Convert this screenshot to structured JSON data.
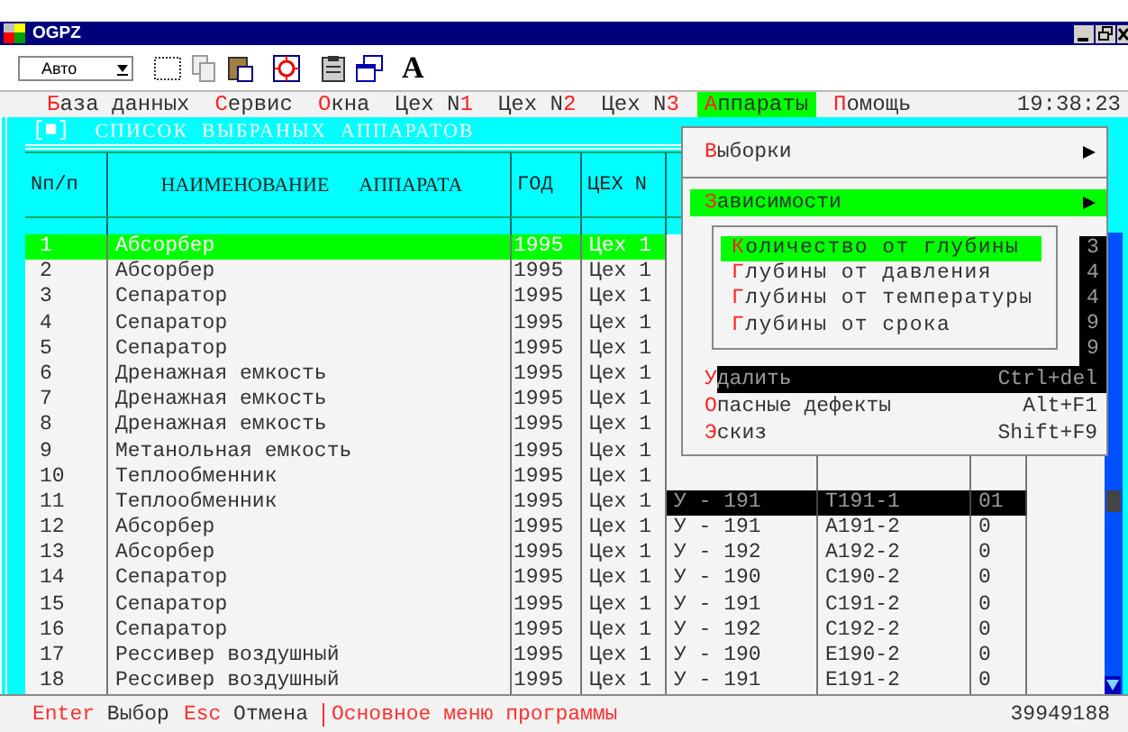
{
  "window": {
    "title": "OGPZ"
  },
  "toolbar": {
    "mode_select": "Авто",
    "font_button": "A"
  },
  "menu_bar": {
    "items": [
      {
        "key": "Б",
        "after": "аза данных",
        "selected": false
      },
      {
        "key": "С",
        "after": "ервис",
        "selected": false
      },
      {
        "key": "О",
        "after": "кна",
        "selected": false
      },
      {
        "before": "Цех N",
        "key": "1",
        "selected": false
      },
      {
        "before": "Цех N",
        "key": "2",
        "selected": false
      },
      {
        "before": "Цех N",
        "key": "3",
        "selected": false
      },
      {
        "key": "А",
        "after": "ппараты",
        "selected": true
      },
      {
        "key": "П",
        "after": "омощь",
        "selected": false
      }
    ],
    "clock": "19:38:23"
  },
  "panel": {
    "marker": "[■]",
    "title": "СПИСОК  ВЫБРАНЫХ  АППАРАТОВ"
  },
  "table": {
    "columns": [
      "Nп/п",
      "НАИМЕНОВАНИЕ      АППАРАТА",
      "ГОД",
      "ЦЕХ N"
    ],
    "rows": [
      {
        "cells": [
          "1",
          "Абсорбер",
          "1995",
          "Цех 1"
        ],
        "selected": true,
        "shadowed": false
      },
      {
        "cells": [
          "2",
          "Абсорбер",
          "1995",
          "Цех 1"
        ],
        "selected": false,
        "shadowed": false
      },
      {
        "cells": [
          "3",
          "Сепаратор",
          "1995",
          "Цех 1"
        ],
        "selected": false,
        "shadowed": false
      },
      {
        "cells": [
          "4",
          "Сепаратор",
          "1995",
          "Цех 1"
        ],
        "selected": false,
        "shadowed": false
      },
      {
        "cells": [
          "5",
          "Сепаратор",
          "1995",
          "Цех 1"
        ],
        "selected": false,
        "shadowed": false
      },
      {
        "cells": [
          "6",
          "Дренажная емкость",
          "1995",
          "Цех 1"
        ],
        "selected": false,
        "shadowed": false
      },
      {
        "cells": [
          "7",
          "Дренажная емкость",
          "1995",
          "Цех 1"
        ],
        "selected": false,
        "shadowed": false
      },
      {
        "cells": [
          "8",
          "Дренажная емкость",
          "1995",
          "Цех 1"
        ],
        "selected": false,
        "shadowed": false
      },
      {
        "cells": [
          "9",
          "Метанольная емкость",
          "1995",
          "Цех 1"
        ],
        "selected": false,
        "shadowed": false
      },
      {
        "cells": [
          "10",
          "Теплообменник",
          "1995",
          "Цех 1"
        ],
        "selected": false,
        "shadowed": false
      },
      {
        "cells": [
          "11",
          "Теплообменник",
          "1995",
          "Цех 1",
          "У - 191",
          "Т191-1",
          "01"
        ],
        "selected": false,
        "shadowed": true
      },
      {
        "cells": [
          "12",
          "Абсорбер",
          "1995",
          "Цех 1",
          "У - 191",
          "А191-2",
          "0"
        ],
        "selected": false,
        "shadowed": false
      },
      {
        "cells": [
          "13",
          "Абсорбер",
          "1995",
          "Цех 1",
          "У - 192",
          "А192-2",
          "0"
        ],
        "selected": false,
        "shadowed": false
      },
      {
        "cells": [
          "14",
          "Сепаратор",
          "1995",
          "Цех 1",
          "У - 190",
          "С190-2",
          "0"
        ],
        "selected": false,
        "shadowed": false
      },
      {
        "cells": [
          "15",
          "Сепаратор",
          "1995",
          "Цех 1",
          "У - 191",
          "С191-2",
          "0"
        ],
        "selected": false,
        "shadowed": false
      },
      {
        "cells": [
          "16",
          "Сепаратор",
          "1995",
          "Цех 1",
          "У - 192",
          "С192-2",
          "0"
        ],
        "selected": false,
        "shadowed": false
      },
      {
        "cells": [
          "17",
          "Рессивер воздушный",
          "1995",
          "Цех 1",
          "У - 190",
          "Е190-2",
          "0"
        ],
        "selected": false,
        "shadowed": false
      },
      {
        "cells": [
          "18",
          "Рессивер воздушный",
          "1995",
          "Цех 1",
          "У - 191",
          "Е191-2",
          "0"
        ],
        "selected": false,
        "shadowed": false
      }
    ]
  },
  "dropdown_menu": {
    "items": [
      {
        "kind": "submenu",
        "key": "В",
        "after": "ыборки",
        "selected": false
      },
      {
        "kind": "separator"
      },
      {
        "kind": "submenu",
        "key": "З",
        "after": "ависимости",
        "selected": true
      },
      {
        "kind": "cascade",
        "shadow_texts": [
          "3",
          "4",
          "4",
          "9",
          "9"
        ],
        "items": [
          {
            "key": "К",
            "after": "оличество от глубины",
            "selected": true
          },
          {
            "key": "Г",
            "after": "лубины от давления",
            "selected": false
          },
          {
            "key": "Г",
            "after": "лубины от температуры",
            "selected": false
          },
          {
            "key": "Г",
            "after": "лубины от срока",
            "selected": false
          }
        ]
      },
      {
        "kind": "command",
        "key": "У",
        "after": "далить",
        "hotkey": "Ctrl+del",
        "selected": false,
        "shadowed": true
      },
      {
        "kind": "command",
        "key": "О",
        "after": "пасные дефекты",
        "hotkey": "Alt+F1",
        "selected": false,
        "shadowed": false
      },
      {
        "kind": "command",
        "key": "Э",
        "after": "скиз",
        "hotkey": "Shift+F9",
        "selected": false,
        "shadowed": false
      }
    ]
  },
  "status_bar": {
    "keys": [
      {
        "key": "Enter",
        "label": "Выбор"
      },
      {
        "key": "Esc",
        "label": "Отмена"
      }
    ],
    "message": "Основное меню программы",
    "number": "39949188"
  }
}
